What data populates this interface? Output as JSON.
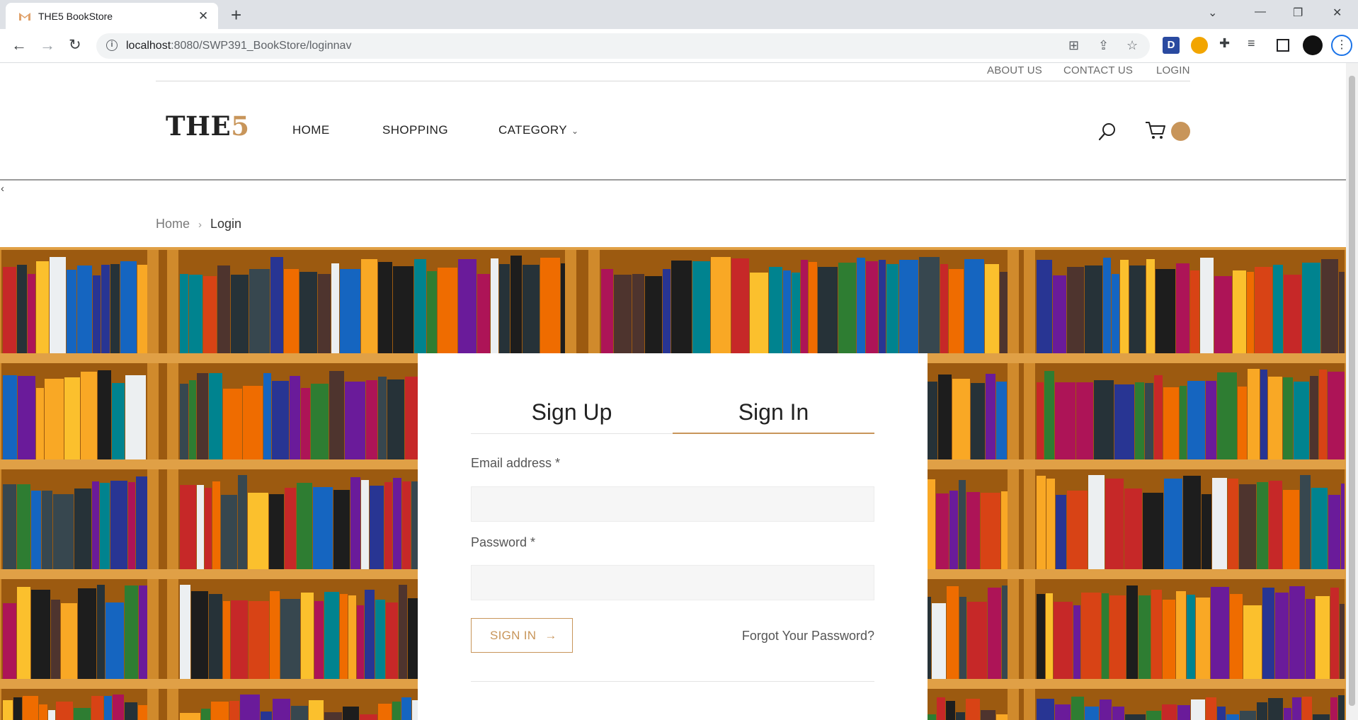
{
  "browser": {
    "tab_title": "THE5 BookStore",
    "url_host": "localhost",
    "url_rest": ":8080/SWP391_BookStore/loginnav"
  },
  "top_links": [
    "ABOUT US",
    "CONTACT US",
    "LOGIN"
  ],
  "logo": {
    "main": "THE",
    "accent": "5"
  },
  "nav": {
    "home": "HOME",
    "shopping": "SHOPPING",
    "category": "CATEGORY"
  },
  "breadcrumb": {
    "home": "Home",
    "current": "Login"
  },
  "login": {
    "tab_signup": "Sign Up",
    "tab_signin": "Sign In",
    "email_label": "Email address *",
    "password_label": "Password *",
    "signin_button": "SIGN IN",
    "forgot": "Forgot Your Password?"
  },
  "colors": {
    "accent": "#c8955a",
    "shelf_wood": "#b56a14"
  },
  "icons": [
    "search-icon",
    "cart-icon",
    "chevron-down-icon",
    "arrow-right-icon"
  ]
}
